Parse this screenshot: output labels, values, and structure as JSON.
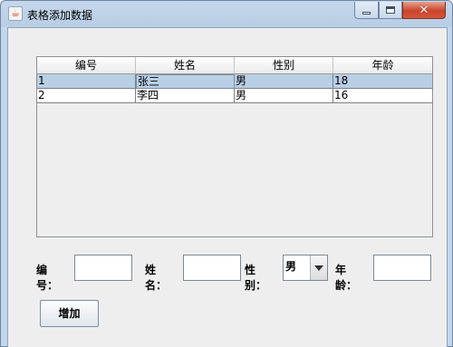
{
  "window": {
    "title": "表格添加数据",
    "icon": "java-cup-icon",
    "controls": {
      "minimize": "minimize",
      "maximize": "maximize",
      "close": "✕"
    }
  },
  "table": {
    "columns": [
      "编号",
      "姓名",
      "性别",
      "年龄"
    ],
    "rows": [
      [
        "1",
        "张三",
        "男",
        "18"
      ],
      [
        "2",
        "李四",
        "男",
        "16"
      ]
    ],
    "selected_row": 0
  },
  "form": {
    "id_label": "编号：",
    "id_value": "",
    "name_label": "姓名：",
    "name_value": "",
    "gender_label": "性别：",
    "gender_value": "男",
    "age_label": "年龄：",
    "age_value": "",
    "add_button": "增加"
  },
  "colors": {
    "selection": "#b8cfe5",
    "panel": "#eeeeee",
    "frame": "#c3d6ea",
    "close_button": "#c8452b"
  }
}
